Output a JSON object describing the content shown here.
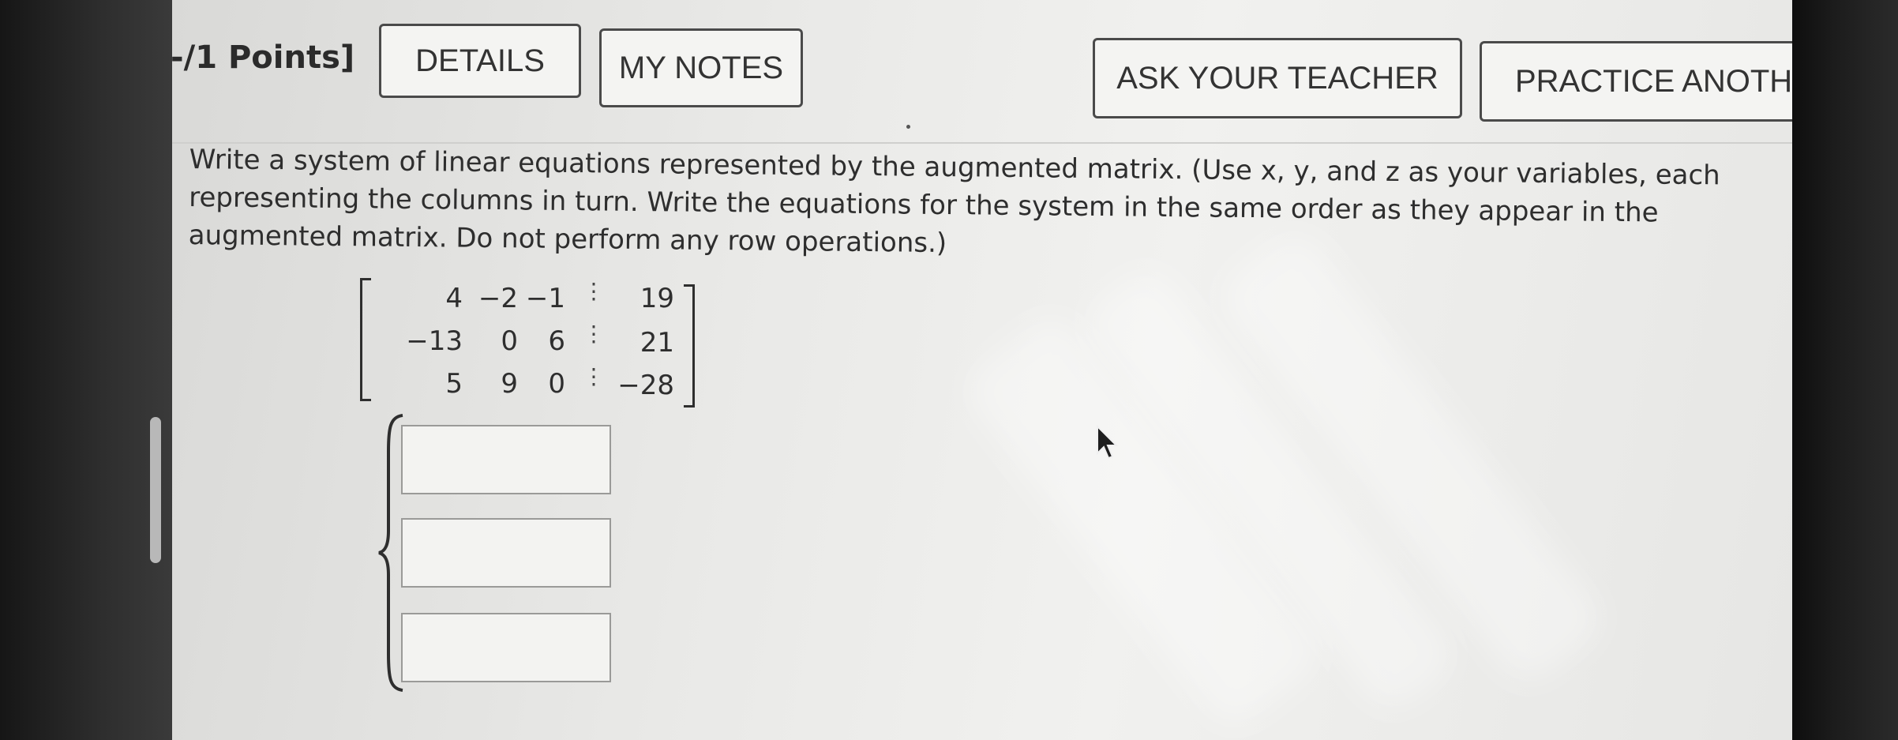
{
  "header": {
    "points_label": "-/1 Points]",
    "buttons": {
      "details": "DETAILS",
      "my_notes": "MY NOTES",
      "ask_teacher": "ASK YOUR TEACHER",
      "practice_another": "PRACTICE ANOTHER"
    }
  },
  "question": {
    "instructions": "Write a system of linear equations represented by the augmented matrix. (Use x, y, and z as your variables, each representing the columns in turn. Write the equations for the system in the same order as they appear in the augmented matrix. Do not perform any row operations.)"
  },
  "matrix": {
    "rows": [
      [
        "4",
        "−2",
        "−1",
        "19"
      ],
      [
        "−13",
        "0",
        "6",
        "21"
      ],
      [
        "5",
        "9",
        "0",
        "−28"
      ]
    ]
  },
  "answers": {
    "equation_1": "",
    "equation_2": "",
    "equation_3": ""
  }
}
